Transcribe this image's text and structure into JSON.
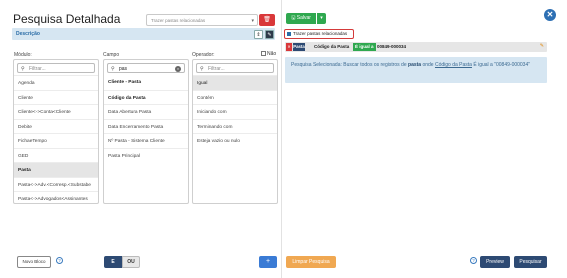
{
  "header": {
    "title": "Pesquisa Detalhada"
  },
  "saved_search": {
    "placeholder": "Trazer pastas relacionadas"
  },
  "description": {
    "label": "Descrição"
  },
  "columns": {
    "modulo": {
      "label": "Módulo:",
      "search_placeholder": "Filtrar...",
      "items": [
        "Agenda",
        "Cliente",
        "Cliente<->Conta<Cliente",
        "Debite",
        "FichaeTempo",
        "GED",
        "Pasta",
        "Pasta<->Adv.<Corresp.<Substabe",
        "Pasta<->Advogados<Assinantes"
      ]
    },
    "campo": {
      "label": "Campo",
      "search_value": "pas",
      "items": [
        "Cliente - Pasta",
        "Código da Pasta",
        "Data Abertura Pasta",
        "Data Encerramento Pasta",
        "Nº Pasta - Sistema Cliente",
        "Pasta Principal"
      ]
    },
    "operador": {
      "label": "Operador:",
      "search_placeholder": "Filtrar...",
      "items": [
        "Igual",
        "Contém",
        "Iniciando com",
        "Terminando com",
        "Esteja vazio ou nulo"
      ]
    }
  },
  "nao_label": "Não",
  "buttons": {
    "novo_bloco": "Novo Bloco",
    "e": "E",
    "ou": "OU",
    "plus": "+",
    "salvar": "Salvar",
    "limpar": "Limpar Pesquisa",
    "preview": "Preview",
    "pesquisar": "Pesquisar"
  },
  "trazer_pastas": "Trazer pastas relacionadas",
  "condition": {
    "module": "Pasta",
    "field": "Código da Pasta",
    "operator": "É igual a",
    "value": "00849-000034"
  },
  "info": {
    "prefix": "Pesquisa Selecionada: Buscar todos os registros de",
    "module": "pasta",
    "mid": "onde",
    "field": "Código da Pasta",
    "op": "É igual a",
    "value": "\"00849-000034\""
  }
}
